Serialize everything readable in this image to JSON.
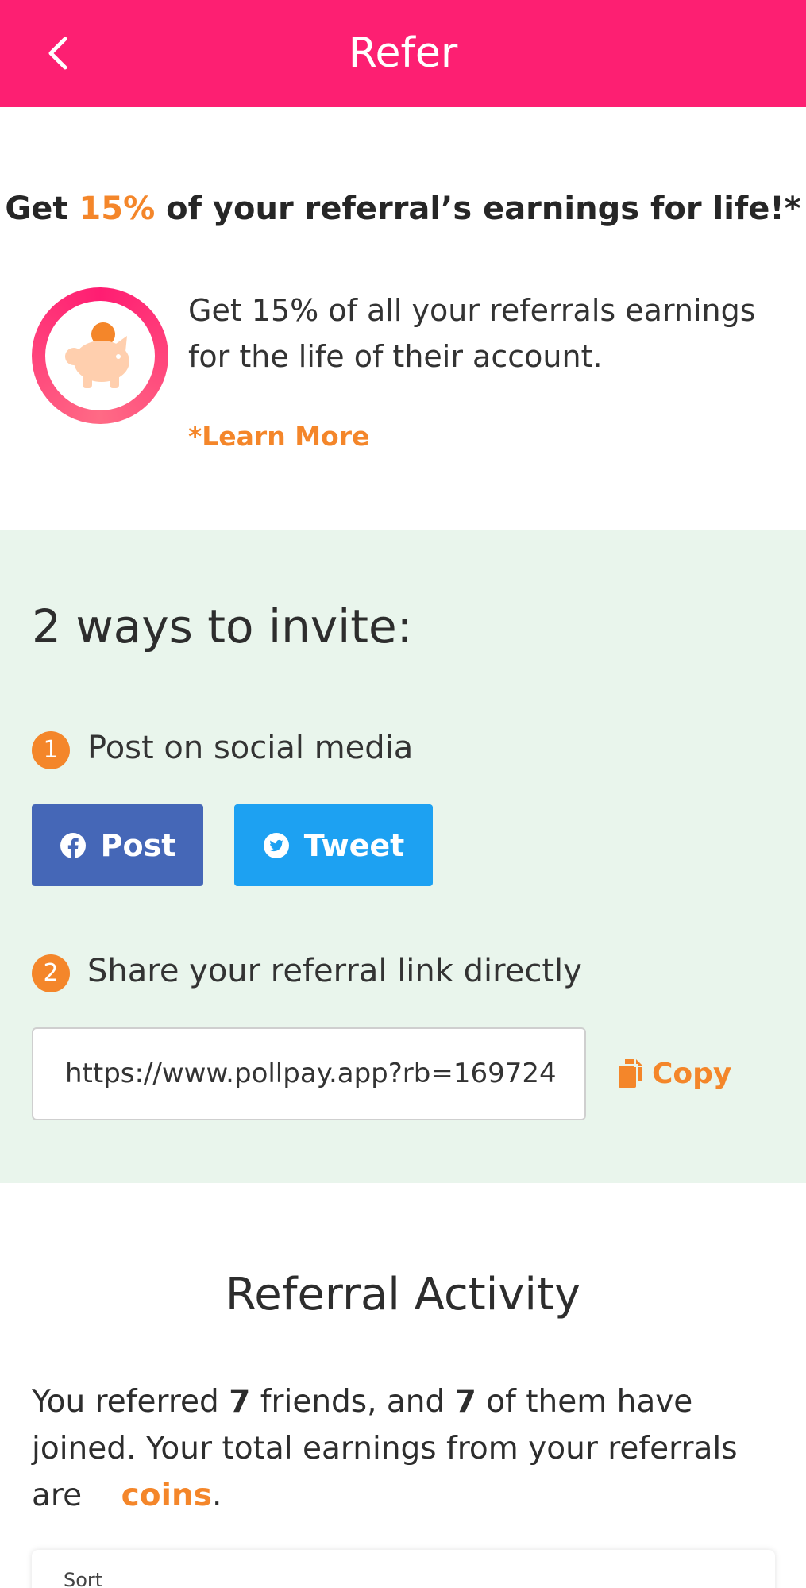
{
  "header": {
    "title": "Refer",
    "background_color": "#fd1f72"
  },
  "promo": {
    "headline_prefix": "Get ",
    "headline_percent": "15%",
    "headline_suffix": " of your referral’s earnings for life!*",
    "description": "Get 15% of all your referrals earnings for the life of their account.",
    "learn_more": "*Learn More",
    "icon": "piggy-bank-icon"
  },
  "invite": {
    "title": "2 ways to invite:",
    "step1": {
      "number": "1",
      "text": "Post on social media"
    },
    "step2": {
      "number": "2",
      "text": "Share your referral link directly"
    },
    "post_button": "Post",
    "tweet_button": "Tweet",
    "referral_link": "https://www.pollpay.app?rb=169724",
    "copy_button": "Copy",
    "section_color": "#e9f5ec"
  },
  "activity": {
    "title": "Referral Activity",
    "text_part1": "You referred ",
    "referred_count": "7",
    "text_part2": " friends, and ",
    "joined_count": "7",
    "text_part3": " of them have joined. Your total earnings from your referrals are ",
    "coins_label": "coins",
    "text_end": ".",
    "sort_label": "Sort"
  },
  "colors": {
    "accent": "#f4862a",
    "brand": "#fd1f72",
    "facebook": "#4567b7",
    "twitter": "#1da1f2"
  }
}
